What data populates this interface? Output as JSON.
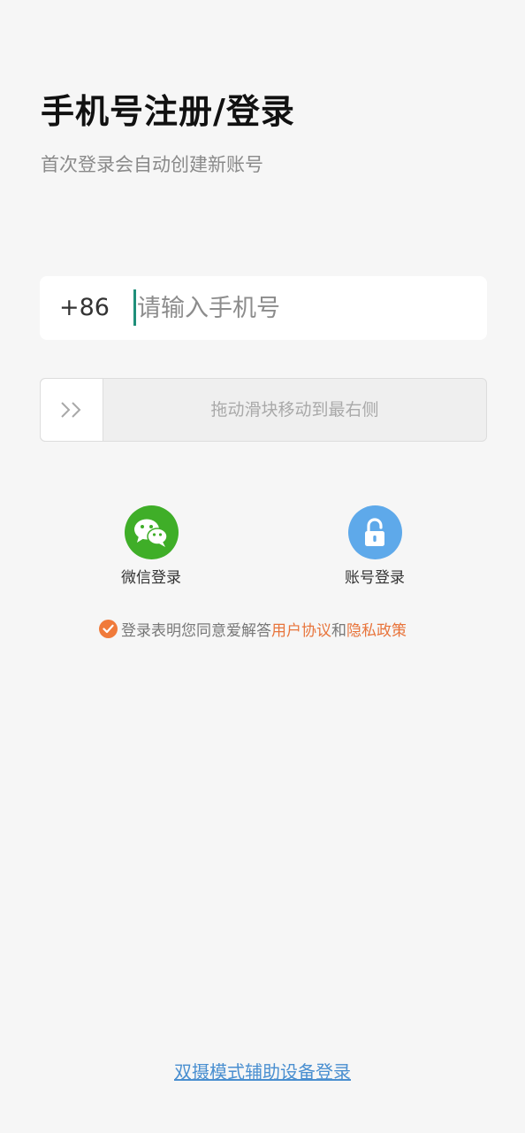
{
  "header": {
    "title": "手机号注册/登录",
    "subtitle": "首次登录会自动创建新账号"
  },
  "phone": {
    "country_code": "+86",
    "placeholder": "请输入手机号",
    "value": ""
  },
  "slider": {
    "hint": "拖动滑块移动到最右侧",
    "handle_icon": "double-chevron-right-icon",
    "progress": 0
  },
  "login_options": {
    "wechat": {
      "label": "微信登录",
      "icon": "wechat-icon",
      "color": "#3fae28"
    },
    "account": {
      "label": "账号登录",
      "icon": "unlock-icon",
      "color": "#5ea9ea"
    }
  },
  "agreement": {
    "checked": true,
    "prefix": "登录表明您同意爱解答",
    "user_agreement": "用户协议",
    "connector": "和",
    "privacy_policy": "隐私政策",
    "accent_color": "#e8743b"
  },
  "footer": {
    "dual_camera_link": "双摄模式辅助设备登录"
  }
}
